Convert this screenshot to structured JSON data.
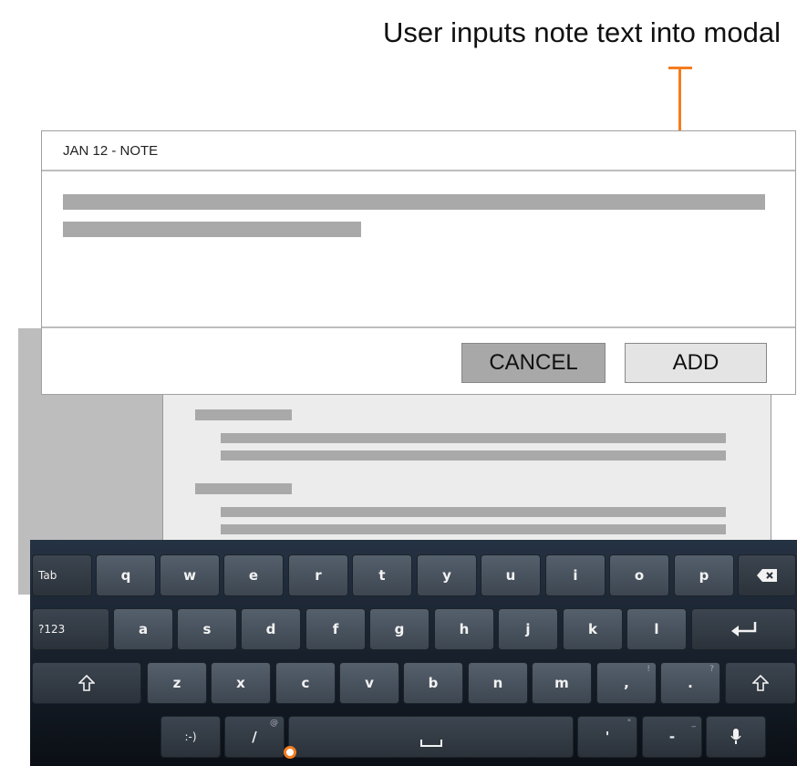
{
  "annotation": {
    "text": "User inputs note text into modal"
  },
  "modal": {
    "title": "JAN 12 - NOTE",
    "cancel_label": "CANCEL",
    "add_label": "ADD"
  },
  "colors": {
    "callout": "#f47d20"
  },
  "keyboard": {
    "row1": [
      "Tab",
      "q",
      "w",
      "e",
      "r",
      "t",
      "y",
      "u",
      "i",
      "o",
      "p",
      "backspace-icon"
    ],
    "row2": [
      "?123",
      "a",
      "s",
      "d",
      "f",
      "g",
      "h",
      "j",
      "k",
      "l",
      "enter-icon"
    ],
    "row3": [
      "shift-icon",
      "z",
      "x",
      "c",
      "v",
      "b",
      "n",
      "m",
      ",",
      ".",
      "shift-icon"
    ],
    "row3_sup": {
      "comma": "!",
      "period": "?"
    },
    "row4": [
      ":-)",
      "/",
      "space-icon",
      "'",
      "-",
      "mic-icon"
    ],
    "row4_sup": {
      "slash": "@",
      "apostrophe": "\"",
      "dash": "_"
    },
    "labels": {
      "tab": "Tab",
      "q": "q",
      "w": "w",
      "e": "e",
      "r": "r",
      "t": "t",
      "y": "y",
      "u": "u",
      "i": "i",
      "o": "o",
      "p": "p",
      "sym": "?123",
      "a": "a",
      "s": "s",
      "d": "d",
      "f": "f",
      "g": "g",
      "h": "h",
      "j": "j",
      "k": "k",
      "l": "l",
      "z": "z",
      "x": "x",
      "c": "c",
      "v": "v",
      "b": "b",
      "n": "n",
      "m": "m",
      "comma": ",",
      "period": ".",
      "smiley": ":-)",
      "slash": "/",
      "apostrophe": "'",
      "dash": "-"
    }
  }
}
